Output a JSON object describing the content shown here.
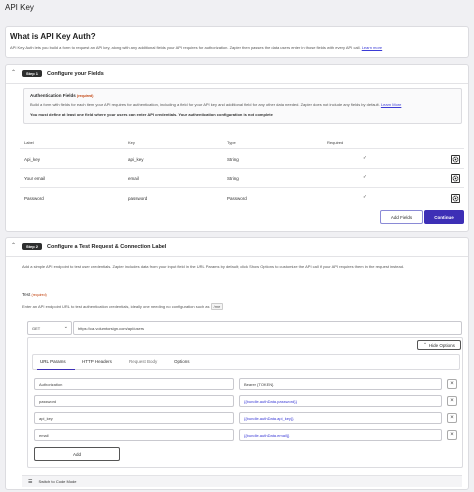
{
  "page": {
    "title": "API Key"
  },
  "intro": {
    "title": "What is API Key Auth?",
    "text": "API Key Auth lets you build a form to request an API key, along with any additional fields your API requires for authorization. Zapier then passes the data users enter in those fields with every API call.",
    "link": "Learn more"
  },
  "step1": {
    "badge": "Step 1",
    "title": "Configure your Fields",
    "auth_fields": {
      "title": "Authentication Fields",
      "required": "(required)",
      "desc": "Build a form with fields for each item your API requires for authentication, including a field for your API key and additional field for any other data needed. Zapier does not include any fields by default.",
      "link": "Learn More",
      "warning": "You must define at least one field where your users can enter API credentials. Your authentication configuration is not complete"
    },
    "columns": {
      "label": "Label",
      "key": "Key",
      "type": "Type",
      "required": "Required"
    },
    "rows": [
      {
        "label": "Api_key",
        "key": "api_key",
        "type": "String",
        "required": "✓"
      },
      {
        "label": "Your email",
        "key": "email",
        "type": "String",
        "required": "✓"
      },
      {
        "label": "Password",
        "key": "password",
        "type": "Password",
        "required": "✓"
      }
    ],
    "add_fields": "Add Fields",
    "continue": "Continue"
  },
  "step2": {
    "badge": "Step 2",
    "title": "Configure a Test Request & Connection Label",
    "desc": "Add a simple API endpoint to test user credentials. Zapier includes data from your input field in the URL Params by default; click Show Options to customize the API call if your API requires them in the request instead.",
    "test_label": "Test",
    "test_required": "(required)",
    "test_help": "Enter an API endpoint URL to test authentication credentials, ideally one needing no configuration such as",
    "test_help_code": "/me",
    "method": "GET",
    "url": "https://ca.volumtorsign.com/api/users",
    "hide_options": "Hide Options",
    "tabs": [
      "URL Params",
      "HTTP Headers",
      "Request Body",
      "Options"
    ],
    "params": [
      {
        "key": "Authorization",
        "value": "Bearer {TOKEN}"
      },
      {
        "key": "password",
        "value": "{{bundle.authData.password}}"
      },
      {
        "key": "api_key",
        "value": "{{bundle.authData.api_key}}"
      },
      {
        "key": "email",
        "value": "{{bundle.authData.email}}"
      }
    ],
    "add": "Add",
    "switch_code": "Switch to Code Mode"
  },
  "colors": {
    "primary": "#3d2fb6",
    "link": "#3b3bd6"
  }
}
